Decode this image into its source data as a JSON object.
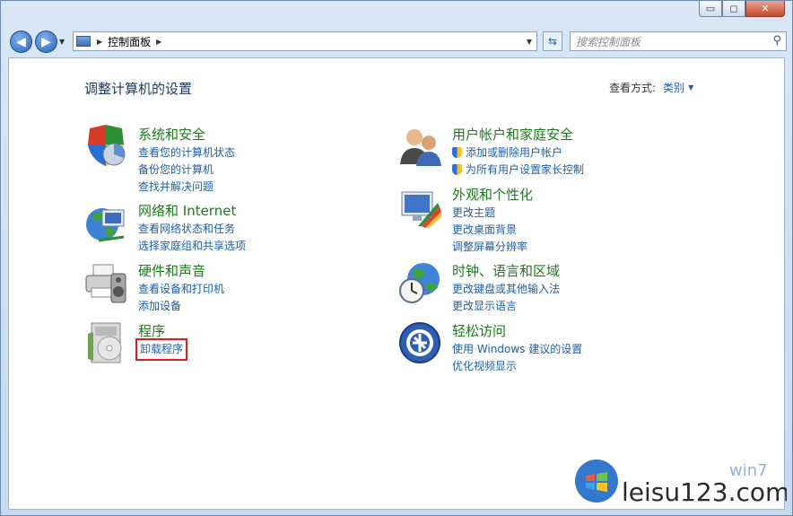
{
  "window": {
    "minimize": "▭",
    "maximize": "◻",
    "close": "✕"
  },
  "nav": {
    "back": "◀",
    "forward": "▶",
    "breadcrumb": "控制面板",
    "search_placeholder": "搜索控制面板"
  },
  "main": {
    "title": "调整计算机的设置",
    "view_label": "查看方式:",
    "view_value": "类别"
  },
  "categories": [
    {
      "title": "系统和安全",
      "icon": "system-security-icon",
      "links": [
        "查看您的计算机状态",
        "备份您的计算机",
        "查找并解决问题"
      ]
    },
    {
      "title": "网络和 Internet",
      "icon": "network-internet-icon",
      "links": [
        "查看网络状态和任务",
        "选择家庭组和共享选项"
      ]
    },
    {
      "title": "硬件和声音",
      "icon": "hardware-sound-icon",
      "links": [
        "查看设备和打印机",
        "添加设备"
      ]
    },
    {
      "title": "程序",
      "icon": "programs-icon",
      "links": [
        "卸载程序"
      ]
    },
    {
      "title": "用户帐户和家庭安全",
      "icon": "user-accounts-icon",
      "links": [
        "添加或删除用户帐户",
        "为所有用户设置家长控制"
      ]
    },
    {
      "title": "外观和个性化",
      "icon": "appearance-icon",
      "links": [
        "更改主题",
        "更改桌面背景",
        "调整屏幕分辨率"
      ]
    },
    {
      "title": "时钟、语言和区域",
      "icon": "clock-language-icon",
      "links": [
        "更改键盘或其他输入法",
        "更改显示语言"
      ]
    },
    {
      "title": "轻松访问",
      "icon": "ease-of-access-icon",
      "links": [
        "使用 Windows 建议的设置",
        "优化视频显示"
      ]
    }
  ],
  "watermark": {
    "text": "leisu123.com",
    "subtext": "win7"
  }
}
